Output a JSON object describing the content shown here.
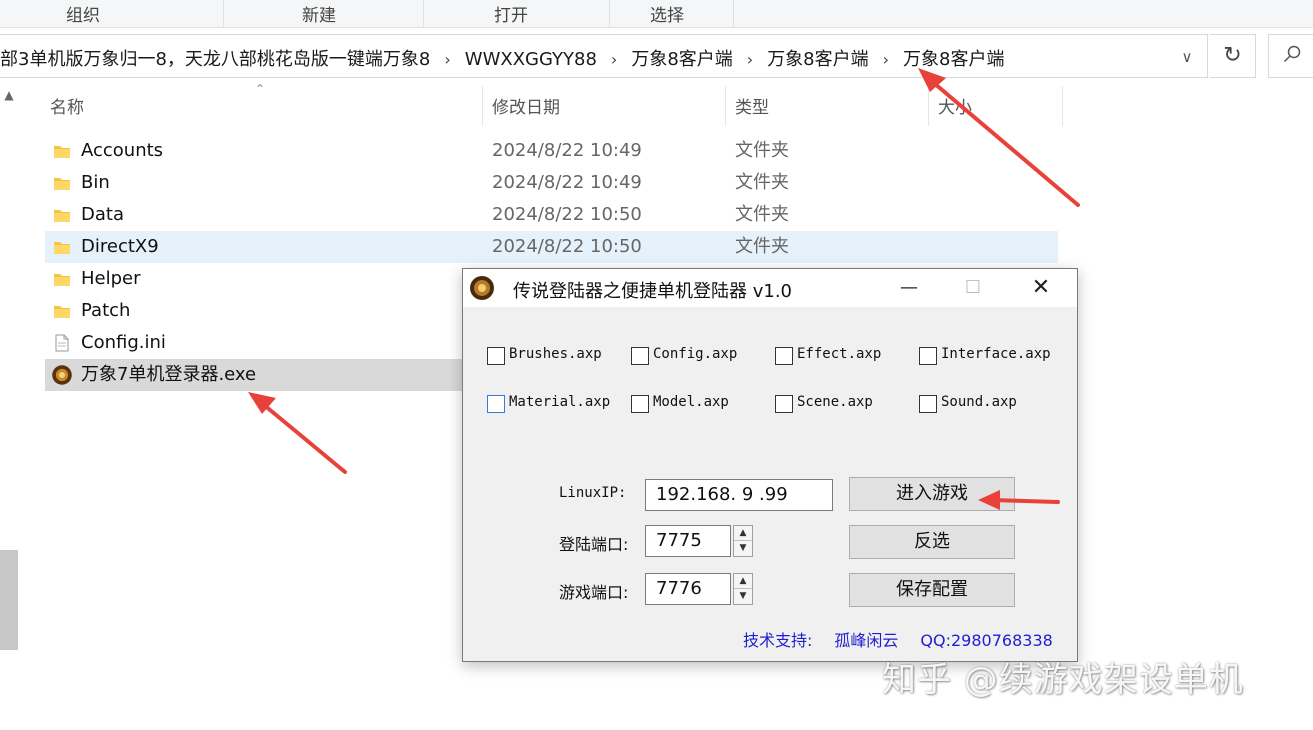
{
  "ribbon": {
    "tabs": [
      "组织",
      "新建",
      "打开",
      "选择"
    ]
  },
  "address": {
    "crumbs": [
      "部3单机版万象归一8，天龙八部桃花岛版一键端万象8",
      "WWXXGGYY88",
      "万象8客户端",
      "万象8客户端",
      "万象8客户端"
    ],
    "separator": "›"
  },
  "columns": {
    "name": "名称",
    "date": "修改日期",
    "type": "类型",
    "size": "大小"
  },
  "files": [
    {
      "name": "Accounts",
      "date": "2024/8/22 10:49",
      "type": "文件夹",
      "icon": "folder-icon"
    },
    {
      "name": "Bin",
      "date": "2024/8/22 10:49",
      "type": "文件夹",
      "icon": "folder-icon"
    },
    {
      "name": "Data",
      "date": "2024/8/22 10:50",
      "type": "文件夹",
      "icon": "folder-icon"
    },
    {
      "name": "DirectX9",
      "date": "2024/8/22 10:50",
      "type": "文件夹",
      "icon": "folder-icon"
    },
    {
      "name": "Helper",
      "date": "",
      "type": "",
      "icon": "folder-icon"
    },
    {
      "name": "Patch",
      "date": "",
      "type": "",
      "icon": "folder-icon"
    },
    {
      "name": "Config.ini",
      "date": "",
      "type": "",
      "icon": "ini-file-icon"
    },
    {
      "name": "万象7单机登录器.exe",
      "date": "",
      "type": "",
      "icon": "exe-app-icon"
    }
  ],
  "dialog": {
    "title": "传说登陆器之便捷单机登陆器 v1.0",
    "checkboxes": [
      "Brushes.axp",
      "Config.axp",
      "Effect.axp",
      "Interface.axp",
      "Material.axp",
      "Model.axp",
      "Scene.axp",
      "Sound.axp"
    ],
    "ip_label": "LinuxIP:",
    "ip_value": "192.168. 9 .99",
    "login_port_label": "登陆端口:",
    "login_port_value": "7775",
    "game_port_label": "游戏端口:",
    "game_port_value": "7776",
    "btn_enter": "进入游戏",
    "btn_invert": "反选",
    "btn_save": "保存配置",
    "support_label": "技术支持:",
    "support_name": "孤峰闲云",
    "support_qq": "QQ:2980768338"
  },
  "watermark": "知乎 @续游戏架设单机",
  "colors": {
    "accent_arrow": "#e8413a",
    "selected_row": "#e5f1fb",
    "support_text": "#1f1fd0"
  }
}
